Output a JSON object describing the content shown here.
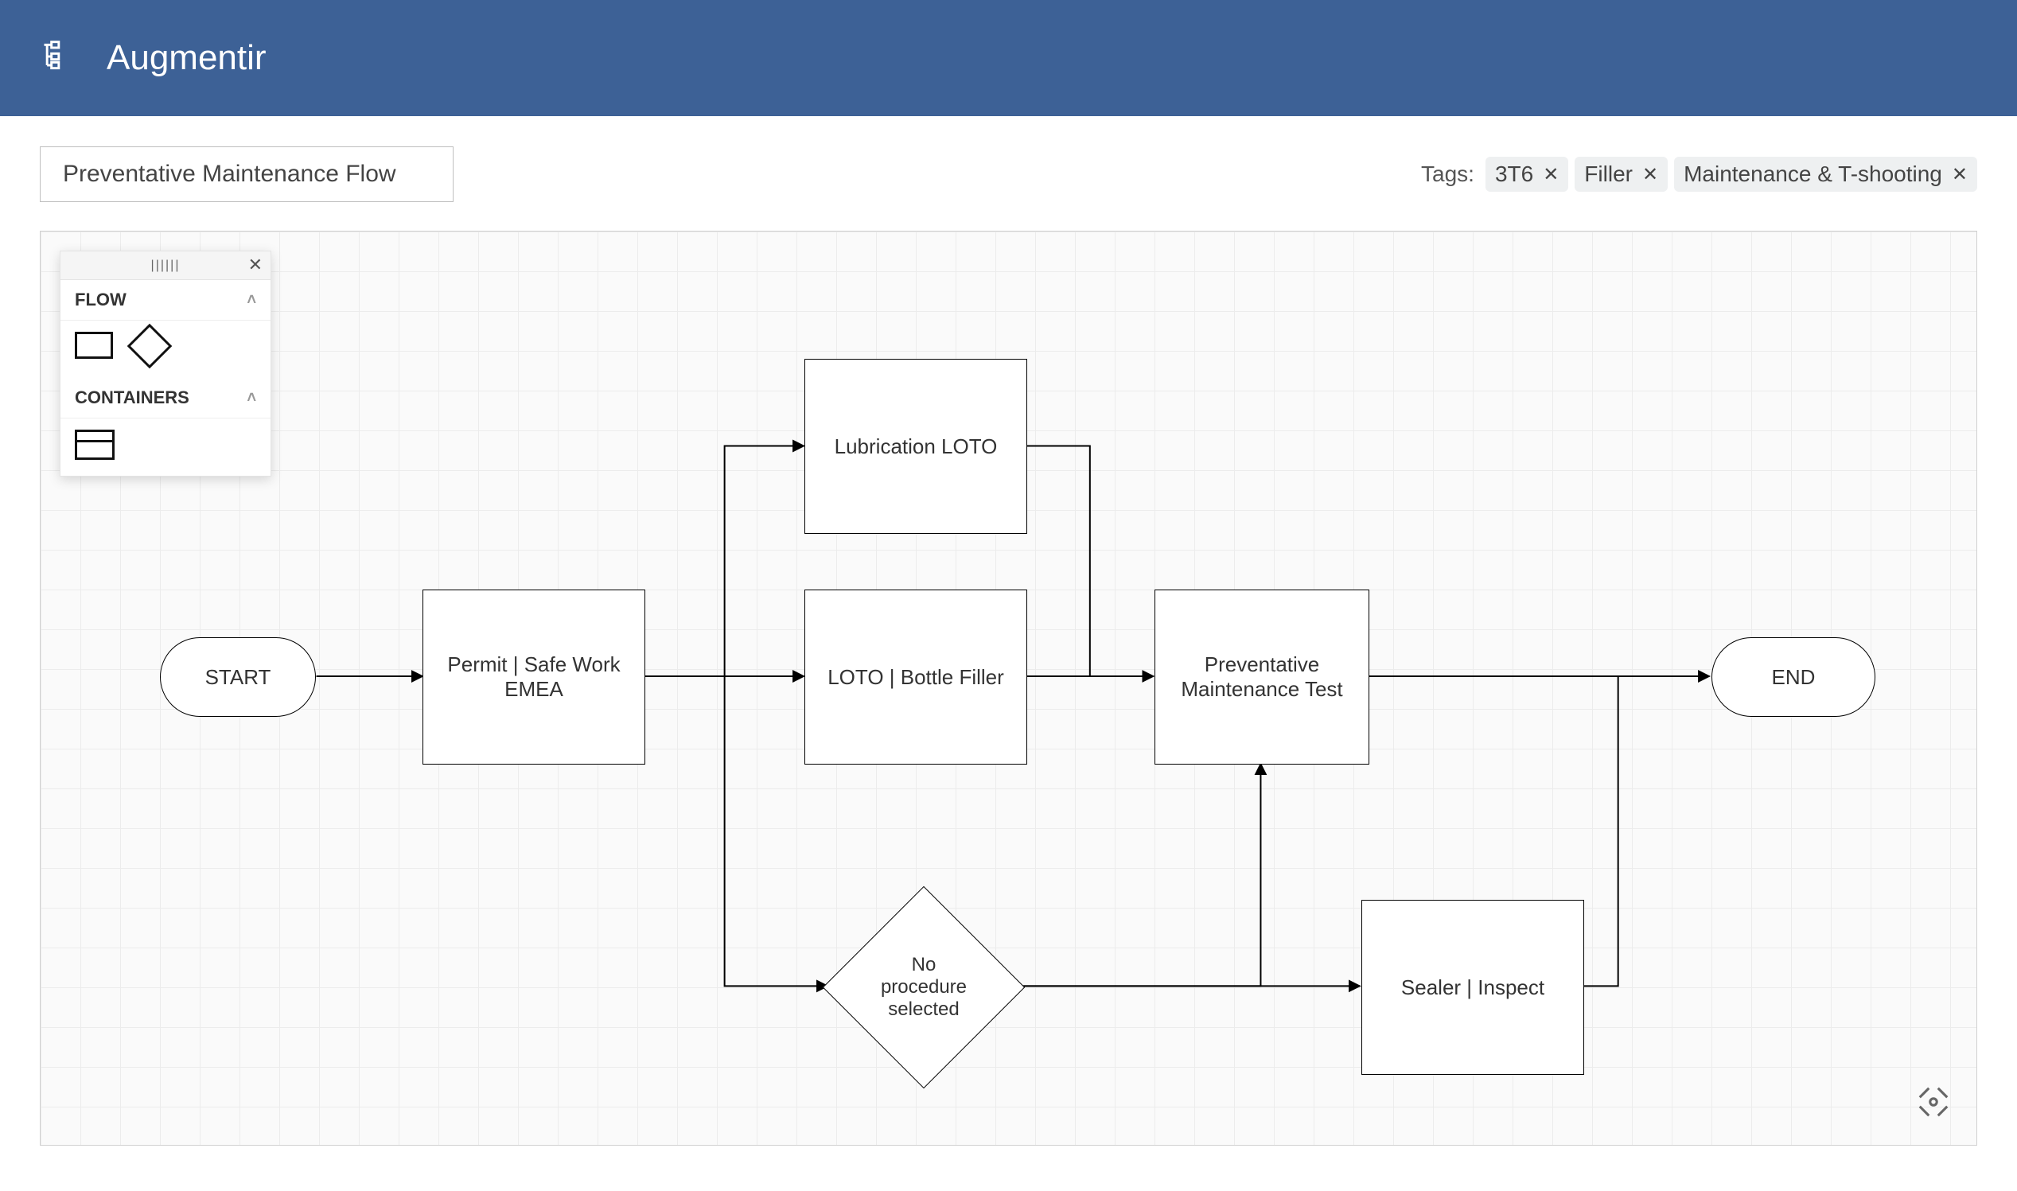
{
  "header": {
    "app_title": "Augmentir"
  },
  "workflow": {
    "title": "Preventative Maintenance Flow"
  },
  "tags": {
    "label": "Tags:",
    "items": [
      {
        "text": "3T6"
      },
      {
        "text": "Filler"
      },
      {
        "text": "Maintenance & T-shooting"
      }
    ]
  },
  "palette": {
    "section_flow": "FLOW",
    "section_containers": "CONTAINERS"
  },
  "nodes": {
    "start": "START",
    "permit": "Permit | Safe Work EMEA",
    "lube": "Lubrication LOTO",
    "loto": "LOTO | Bottle Filler",
    "decision": "No procedure selected",
    "pm": "Preventative Maintenance Test",
    "sealer": "Sealer | Inspect",
    "end": "END"
  }
}
